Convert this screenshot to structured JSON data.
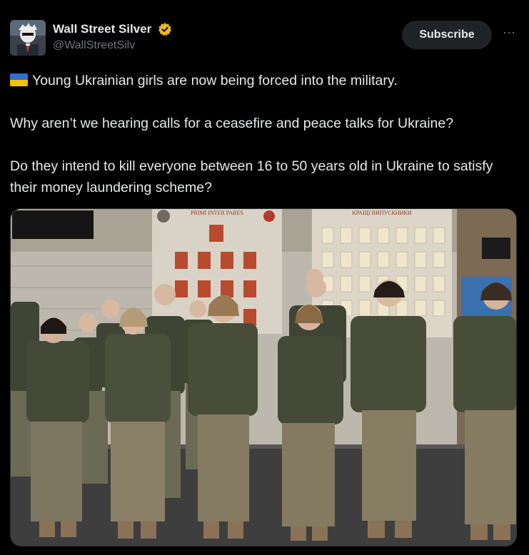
{
  "author": {
    "display_name": "Wall Street Silver",
    "handle": "@WallStreetSilv",
    "verified_badge_color": "#e8b829"
  },
  "actions": {
    "subscribe_label": "Subscribe",
    "more_icon": "···"
  },
  "post": {
    "flag_icon": "ukraine-flag",
    "line1": "Young Ukrainian girls are now being forced into the military.",
    "line2": "Why aren’t we hearing calls for a ceasefire and peace talks for Ukraine?",
    "line3": "Do they intend to kill everyone between 16 to 50 years old in Ukraine to satisfy their money laundering scheme?"
  },
  "media": {
    "description_icon": "photo-soldiers",
    "sign_left": "PRIMI INTER PARES",
    "sign_right": "КРАЩІ ВИПУСКНИКИ"
  },
  "colors": {
    "background": "#000000",
    "text": "#e7e9ea",
    "muted": "#71767b",
    "button_bg": "#1f2326"
  }
}
